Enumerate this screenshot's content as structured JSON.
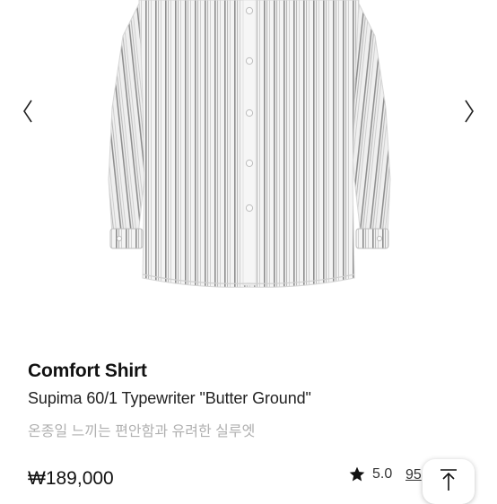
{
  "product": {
    "name": "Comfort Shirt",
    "subtitle": "Supima 60/1 Typewriter \"Butter Ground\"",
    "tagline": "온종일 느끼는 편안함과 유려한 실루엣",
    "price": "₩189,000",
    "rating": "5.0",
    "review_count": "95"
  },
  "icons": {
    "prev": "chevron-left-icon",
    "next": "chevron-right-icon",
    "star": "star-icon",
    "scroll_top": "arrow-up-to-top-icon"
  },
  "colors": {
    "tagline": "#b0b0b0",
    "shirt_base": "#f3f3f3",
    "stripe": "#9a9a9a"
  }
}
